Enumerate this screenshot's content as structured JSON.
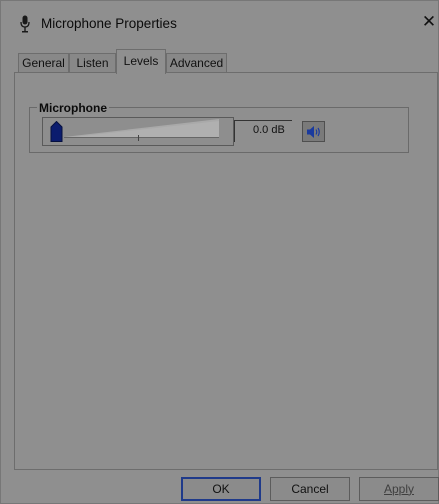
{
  "window": {
    "title": "Microphone Properties",
    "close_glyph": "✕"
  },
  "tabs": [
    {
      "label": "General",
      "active": false
    },
    {
      "label": "Listen",
      "active": false
    },
    {
      "label": "Levels",
      "active": true
    },
    {
      "label": "Advanced",
      "active": false
    }
  ],
  "levels": {
    "group_label": "Microphone",
    "level_percent": 0,
    "value_text": "0.0 dB",
    "mute_icon": "speaker-icon"
  },
  "footer": {
    "ok_label": "OK",
    "cancel_label": "Cancel",
    "apply_label": "Apply"
  },
  "colors": {
    "accent": "#1f3a8a",
    "thumb": "#0b1c6e"
  }
}
